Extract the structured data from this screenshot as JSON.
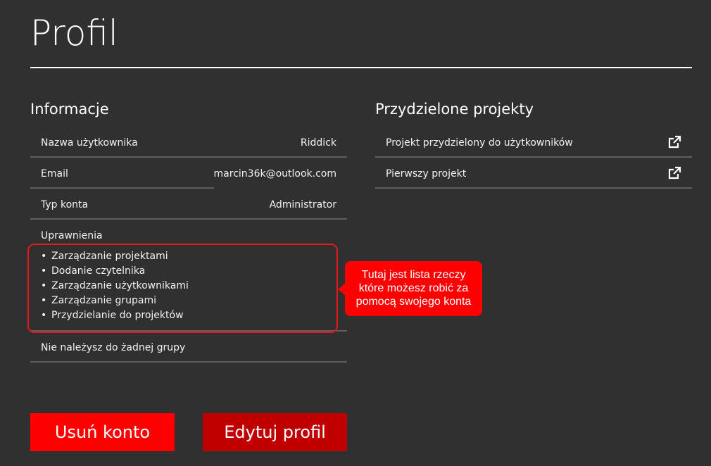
{
  "page": {
    "title": "Profil"
  },
  "info": {
    "heading": "Informacje",
    "username": {
      "label": "Nazwa użytkownika",
      "value": "Riddick"
    },
    "email": {
      "label": "Email",
      "value": "marcin36k@outlook.com"
    },
    "account_type": {
      "label": "Typ konta",
      "value": "Administrator"
    },
    "permissions": {
      "label": "Uprawnienia",
      "items": [
        "Zarządzanie projektami",
        "Dodanie czytelnika",
        "Zarządzanie użytkownikami",
        "Zarządzanie grupami",
        "Przydzielanie do projektów"
      ]
    },
    "groups_text": "Nie należysz do żadnej grupy"
  },
  "callout": {
    "lines": [
      "Tutaj jest lista rzeczy",
      "które możesz robić za",
      "pomocą swojego konta"
    ]
  },
  "projects": {
    "heading": "Przydzielone projekty",
    "items": [
      {
        "name": "Projekt przydzielony do użytkowników",
        "icon": "external-link-icon"
      },
      {
        "name": "Pierwszy projekt",
        "icon": "external-link-icon"
      }
    ]
  },
  "actions": {
    "delete_label": "Usuń konto",
    "edit_label": "Edytuj profil"
  },
  "colors": {
    "background": "#303030",
    "accent_red": "#ff0000",
    "dark_red": "#c00000"
  }
}
